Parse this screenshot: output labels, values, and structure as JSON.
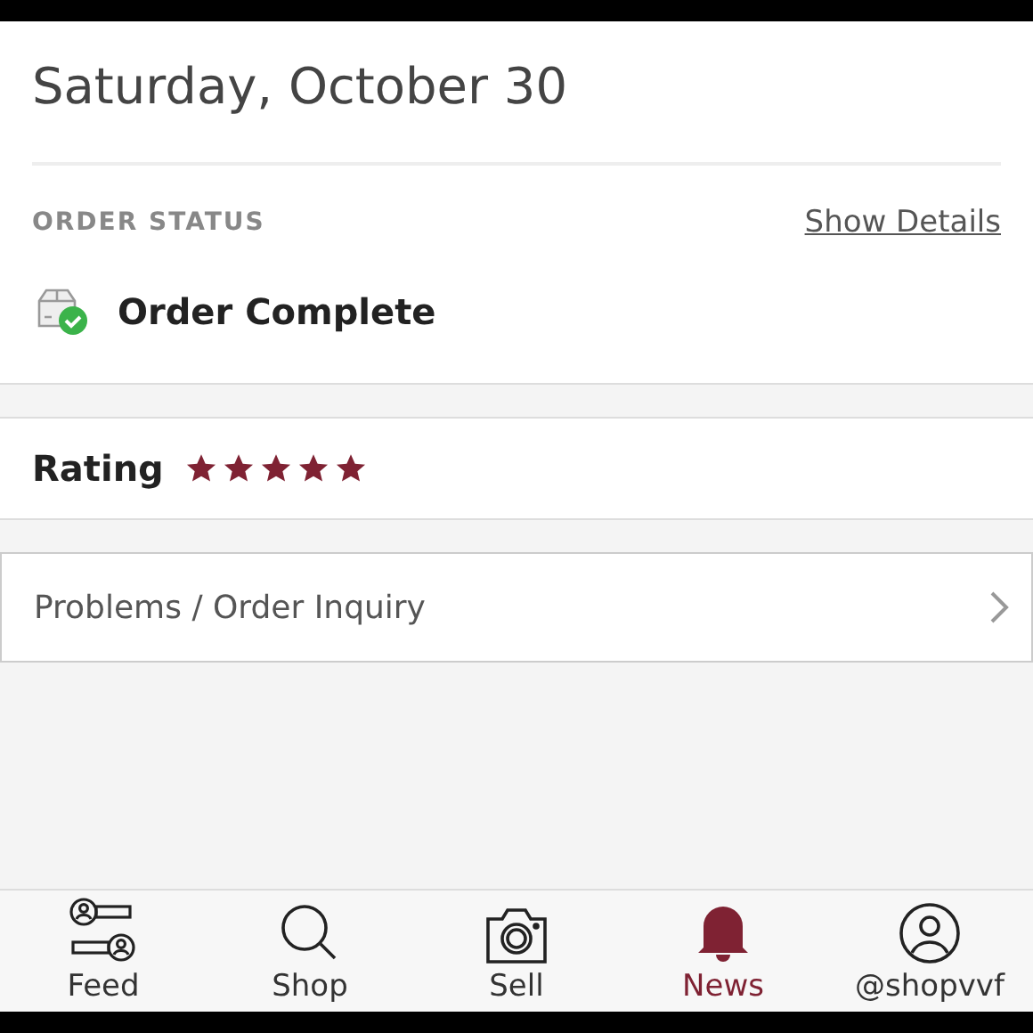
{
  "date": "Saturday, October 30",
  "order_status": {
    "label": "ORDER STATUS",
    "link": "Show Details",
    "status": "Order Complete"
  },
  "rating": {
    "label": "Rating",
    "stars": 5
  },
  "inquiry": {
    "label": "Problems / Order Inquiry"
  },
  "tab_bar": [
    {
      "label": "Feed",
      "kind": "feed",
      "selected": false
    },
    {
      "label": "Shop",
      "kind": "search",
      "selected": false
    },
    {
      "label": "Sell",
      "kind": "camera",
      "selected": false
    },
    {
      "label": "News",
      "kind": "bell",
      "selected": true
    },
    {
      "label": "@shopvvf",
      "kind": "profile",
      "selected": false
    }
  ]
}
